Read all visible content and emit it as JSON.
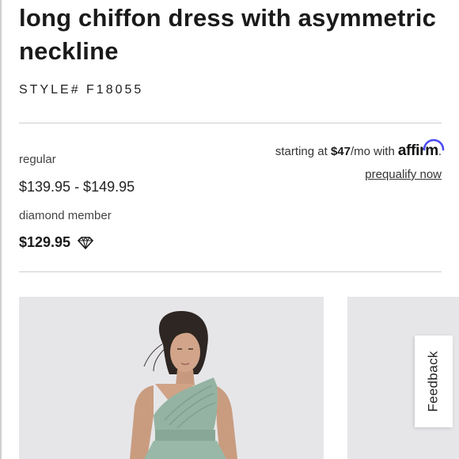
{
  "product": {
    "title": "long chiffon dress with asymmetric neckline",
    "style_number": "STYLE# F18055"
  },
  "pricing": {
    "regular_label": "regular",
    "regular_price": "$139.95 - $149.95",
    "member_label": "diamond member",
    "member_price": "$129.95",
    "member_icon": "diamond-icon"
  },
  "financing": {
    "prefix": "starting at ",
    "amount": "$47",
    "suffix": "/mo with ",
    "brand": "affirm",
    "period": ".",
    "prequalify_link": "prequalify now"
  },
  "feedback": {
    "label": "Feedback"
  },
  "colors": {
    "dress": "#94b3a2",
    "photo_background": "#e6e6e9",
    "affirm_arc": "#4a4af4"
  }
}
